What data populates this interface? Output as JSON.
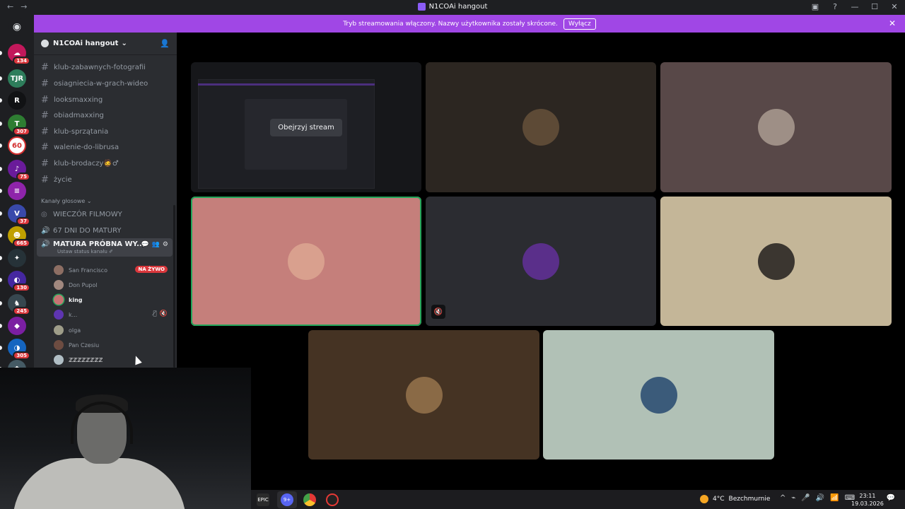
{
  "window": {
    "title": "N1COAi hangout",
    "back": "←",
    "forward": "→",
    "controls": [
      "▣",
      "?",
      "—",
      "☐",
      "✕"
    ]
  },
  "banner": {
    "text": "Tryb streamowania włączony. Nazwy użytkownika zostały skrócone.",
    "button": "Wyłącz",
    "close": "✕"
  },
  "rail": {
    "home_glyph": "◉",
    "servers": [
      {
        "badge": "134",
        "color": "#c2185b",
        "glyph": "☁"
      },
      {
        "badge": "",
        "color": "#2e7d5b",
        "glyph": "TJR"
      },
      {
        "badge": "",
        "color": "#111214",
        "glyph": "R"
      },
      {
        "badge": "307",
        "color": "#2e7d32",
        "glyph": "T"
      },
      {
        "badge": "",
        "color": "#ffffff",
        "glyph": "60"
      },
      {
        "badge": "75",
        "color": "#6a1b9a",
        "glyph": "♪"
      },
      {
        "badge": "",
        "color": "#8e24aa",
        "glyph": "≡"
      },
      {
        "badge": "37",
        "color": "#3949ab",
        "glyph": "V"
      },
      {
        "badge": "665",
        "color": "#c0a000",
        "glyph": "☻"
      },
      {
        "badge": "",
        "color": "#263238",
        "glyph": "✦"
      },
      {
        "badge": "130",
        "color": "#4527a0",
        "glyph": "◐"
      },
      {
        "badge": "245",
        "color": "#37474f",
        "glyph": "♞"
      },
      {
        "badge": "",
        "color": "#7b1fa2",
        "glyph": "◆"
      },
      {
        "badge": "305",
        "color": "#1565c0",
        "glyph": "◑"
      },
      {
        "badge": "",
        "color": "#455a64",
        "glyph": "✿"
      }
    ]
  },
  "sidebar": {
    "guild_name": "N1COAi hangout",
    "chevron": "⌄",
    "invite_icon": "👤",
    "text_channels": [
      "klub-zabawnych-fotografii",
      "osiagniecia-w-grach-wideo",
      "looksmaxxing",
      "obiadmaxxing",
      "klub-sprzątania",
      "walenie-do-librusa",
      "klub-brodaczy🧔♂",
      "życie"
    ],
    "hash": "#",
    "voice_category": "Kanały głosowe",
    "voice_channels": [
      {
        "name": "WIECZÓR FILMOWY",
        "glyph": "◎"
      },
      {
        "name": "67 DNI DO MATURY",
        "glyph": "🔊"
      }
    ],
    "active_voice": {
      "name": "MATURA PRÓBNA WY...",
      "status": "Ustaw status kanału ✐",
      "glyph": "🔊",
      "icons": [
        "💬",
        "👥",
        "⚙"
      ]
    },
    "users": [
      {
        "name": "San Francisco",
        "live": "NA ŻYWO",
        "color": "#8d6e63"
      },
      {
        "name": "Don Pupol",
        "live": "",
        "color": "#a1887f"
      },
      {
        "name": "king",
        "live": "",
        "color": "#c77373"
      },
      {
        "name": "k...",
        "live": "",
        "color": "#5e35b1",
        "icons": [
          "🎙̸",
          "🔇"
        ]
      },
      {
        "name": "olga",
        "live": "",
        "color": "#9e9d89"
      },
      {
        "name": "Pan Czesiu",
        "live": "",
        "color": "#6d4c41"
      },
      {
        "name": "ℤℤℤℤℤℤℤℤ",
        "live": "",
        "color": "#b0bec5"
      }
    ]
  },
  "main": {
    "watch_stream": "Obejrzyj stream",
    "muted_icon": "🔇",
    "tiles": [
      {
        "bg": "#16171a",
        "type": "stream"
      },
      {
        "bg": "#2c2621",
        "avatar": "#5d4a36"
      },
      {
        "bg": "#584848",
        "avatar": "#9e8f86"
      },
      {
        "bg": "#c57f7b",
        "avatar": "#d9a08e",
        "speaking": true
      },
      {
        "bg": "#2b2c31",
        "avatar": "#5a2f8a",
        "muted": true
      },
      {
        "bg": "#c4b698",
        "avatar": "#3b3630"
      },
      {
        "bg": "#453323",
        "avatar": "#8a6a46"
      },
      {
        "bg": "#b1c1b6",
        "avatar": "#3b5b7a"
      }
    ]
  },
  "taskbar": {
    "apps": [
      {
        "label": "EPIC",
        "color": "#2b2b2b"
      },
      {
        "label": "9+",
        "color": "#5865f2"
      },
      {
        "label": "",
        "color": "#e53935"
      },
      {
        "label": "",
        "color": "#222222"
      }
    ],
    "weather": {
      "temp": "4°C",
      "desc": "Bezchmurnie"
    },
    "tray": [
      "^",
      "⌁",
      "🎤",
      "🔊",
      "📶",
      "⌨"
    ],
    "time": "23:11",
    "date": "19.03.2026",
    "notif": "💬"
  }
}
